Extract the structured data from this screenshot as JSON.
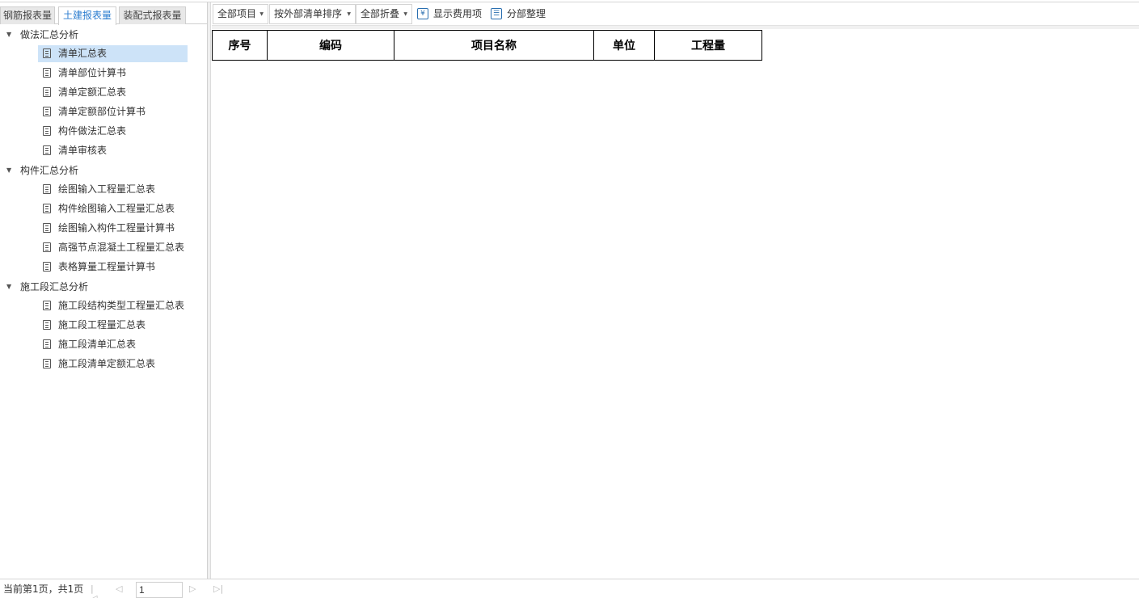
{
  "tabs": [
    {
      "label": "钢筋报表量",
      "active": false
    },
    {
      "label": "土建报表量",
      "active": true
    },
    {
      "label": "装配式报表量",
      "active": false
    }
  ],
  "tree": {
    "groups": [
      {
        "label": "做法汇总分析",
        "items": [
          "清单汇总表",
          "清单部位计算书",
          "清单定额汇总表",
          "清单定额部位计算书",
          "构件做法汇总表",
          "清单审核表"
        ]
      },
      {
        "label": "构件汇总分析",
        "items": [
          "绘图输入工程量汇总表",
          "构件绘图输入工程量汇总表",
          "绘图输入构件工程量计算书",
          "高强节点混凝土工程量汇总表",
          "表格算量工程量计算书"
        ]
      },
      {
        "label": "施工段汇总分析",
        "items": [
          "施工段结构类型工程量汇总表",
          "施工段工程量汇总表",
          "施工段清单汇总表",
          "施工段清单定额汇总表"
        ]
      }
    ],
    "selected": "清单汇总表"
  },
  "toolbar": {
    "filter_all_items": "全部项目",
    "sort_order": "按外部清单排序",
    "collapse_all": "全部折叠",
    "show_fee_items": "显示费用项",
    "partial_arrange": "分部整理"
  },
  "table": {
    "headers": [
      "序号",
      "编码",
      "项目名称",
      "单位",
      "工程量"
    ]
  },
  "status": {
    "page_info": "当前第1页，共1页",
    "page_value": "1"
  },
  "colors": {
    "accent": "#2a7ccf",
    "selected_bg": "#cde3f8"
  }
}
